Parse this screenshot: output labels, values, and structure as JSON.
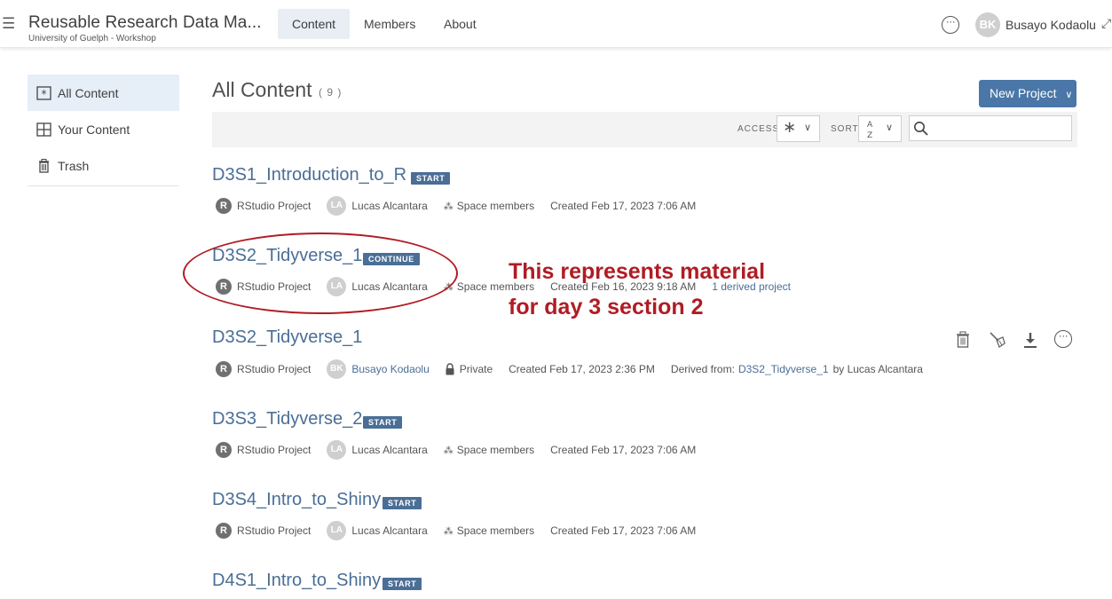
{
  "header": {
    "space_title": "Reusable Research Data Ma...",
    "space_subtitle": "University of Guelph - Workshop",
    "tabs": [
      "Content",
      "Members",
      "About"
    ],
    "user_initials": "BK",
    "user_name": "Busayo Kodaolu"
  },
  "sidebar": {
    "items": [
      {
        "label": "All Content",
        "icon": "asterisk-box-icon"
      },
      {
        "label": "Your Content",
        "icon": "grid-icon"
      },
      {
        "label": "Trash",
        "icon": "trash-icon"
      }
    ]
  },
  "main": {
    "title": "All Content",
    "count": "( 9 )",
    "new_project_label": "New Project",
    "access_label": "ACCESS",
    "sort_label": "SORT"
  },
  "projects": [
    {
      "title": "D3S1_Introduction_to_R",
      "badge": "START",
      "type": "RStudio Project",
      "owner_initials": "LA",
      "owner": "Lucas Alcantara",
      "access": "Space members",
      "created": "Created Feb 17, 2023 7:06 AM"
    },
    {
      "title": "D3S2_Tidyverse_1",
      "badge": "CONTINUE",
      "type": "RStudio Project",
      "owner_initials": "LA",
      "owner": "Lucas Alcantara",
      "access": "Space members",
      "created": "Created Feb 16, 2023 9:18 AM",
      "derived": "1 derived project"
    },
    {
      "title": "D3S2_Tidyverse_1",
      "type": "RStudio Project",
      "owner_initials": "BK",
      "owner": "Busayo Kodaolu",
      "access": "Private",
      "created": "Created Feb 17, 2023 2:36 PM",
      "derived_from_label": "Derived from:",
      "derived_from": "D3S2_Tidyverse_1",
      "derived_by": "by Lucas Alcantara"
    },
    {
      "title": "D3S3_Tidyverse_2",
      "badge": "START",
      "type": "RStudio Project",
      "owner_initials": "LA",
      "owner": "Lucas Alcantara",
      "access": "Space members",
      "created": "Created Feb 17, 2023 7:06 AM"
    },
    {
      "title": "D3S4_Intro_to_Shiny",
      "badge": "START",
      "type": "RStudio Project",
      "owner_initials": "LA",
      "owner": "Lucas Alcantara",
      "access": "Space members",
      "created": "Created Feb 17, 2023 7:06 AM"
    },
    {
      "title": "D4S1_Intro_to_Shiny",
      "badge": "START"
    }
  ],
  "annotation": {
    "line1": "This represents material",
    "line2": "for day 3 section 2"
  },
  "colors": {
    "accent": "#4a6e96",
    "button": "#4a77a7",
    "annotation": "#b01c24"
  }
}
